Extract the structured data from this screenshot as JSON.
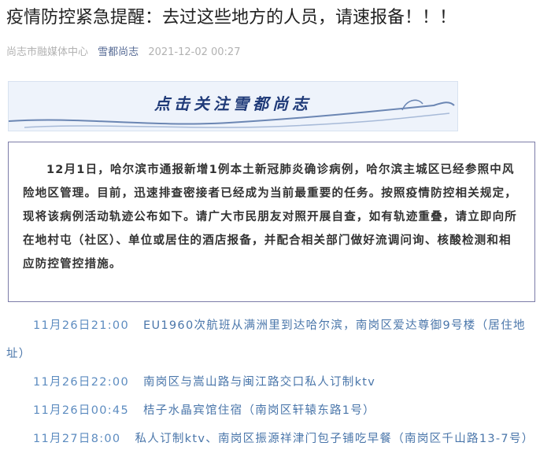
{
  "article": {
    "title": "疫情防控紧急提醒：去过这些地方的人员，请速报备！！！",
    "source": "尚志市融媒体中心",
    "account": "雪都尚志",
    "publish_time": "2021-12-02 00:27"
  },
  "banner": {
    "text": "点击关注雪都尚志"
  },
  "notice": {
    "date": "12月1日",
    "body": "，哈尔滨市通报新增1例本土新冠肺炎确诊病例，哈尔滨主城区已经参照中风险地区管理。目前，迅速排查密接者已经成为当前最重要的任务。按照疫情防控相关规定，现将该病例活动轨迹公布如下。请广大市民朋友对照开展自查，如有轨迹重叠，请立即向所在地村屯（社区）、单位或居住的酒店报备，并配合相关部门做好流调问询、核酸检测和相应防控管控措施。"
  },
  "timeline": [
    {
      "time": "11月26日21:00",
      "location": "EU1960次航班从满洲里到达哈尔滨，南岗区爱达尊御9号楼（居住地址）"
    },
    {
      "time": "11月26日22:00",
      "location": "南岗区与嵩山路与闽江路交口私人订制ktv"
    },
    {
      "time": "11月26日00:45",
      "location": "桔子水晶宾馆住宿（南岗区轩辕东路1号）"
    },
    {
      "time": "11月27日8:00",
      "location": "私人订制ktv、南岗区振源祥津门包子铺吃早餐（南岗区千山路13-7号）"
    }
  ],
  "colors": {
    "account_link": "#576b95",
    "timeline_text": "#4a76aa",
    "notice_border": "#7c7ca8",
    "banner_text": "#1f3a78"
  }
}
